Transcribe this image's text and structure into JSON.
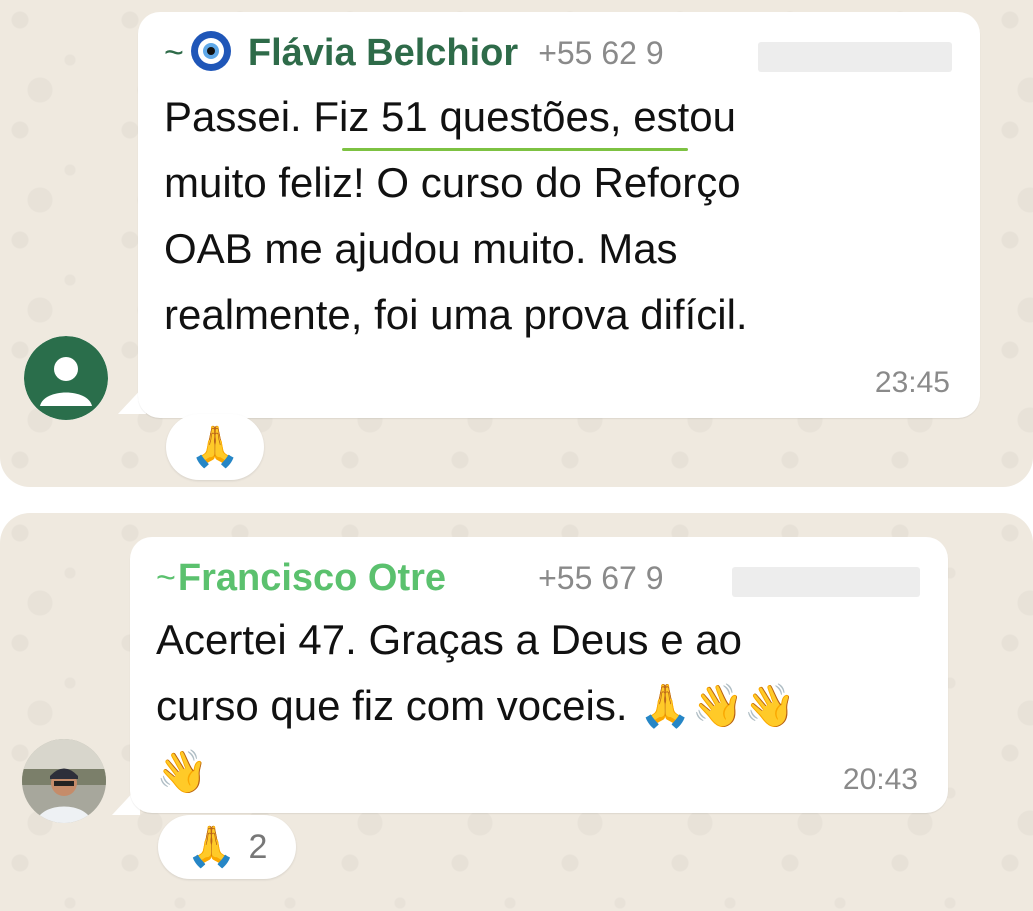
{
  "messages": [
    {
      "sender_prefix": "~",
      "sender_badge": "🧿",
      "sender_name": "Flávia Belchior",
      "sender_color": "#2e6b49",
      "phone": "+55 62 9",
      "text_lines": [
        "Passei. Fiz 51 questões, estou",
        "muito feliz! O curso do Reforço",
        "OAB me ajudou muito. Mas",
        "realmente, foi uma prova difícil."
      ],
      "time": "23:45",
      "reaction": {
        "emoji": "🙏",
        "count": ""
      },
      "avatar": "default-user-avatar"
    },
    {
      "sender_prefix": "~",
      "sender_name": "Francisco Otre",
      "sender_color": "#5bc16e",
      "phone": "+55 67 9",
      "text_lines": [
        "Acertei 47. Graças a Deus e ao",
        "curso que fiz com voceis. 🙏👋👋",
        "👋"
      ],
      "time": "20:43",
      "reaction": {
        "emoji": "🙏",
        "count": "2"
      },
      "avatar": "user-photo-avatar"
    }
  ]
}
